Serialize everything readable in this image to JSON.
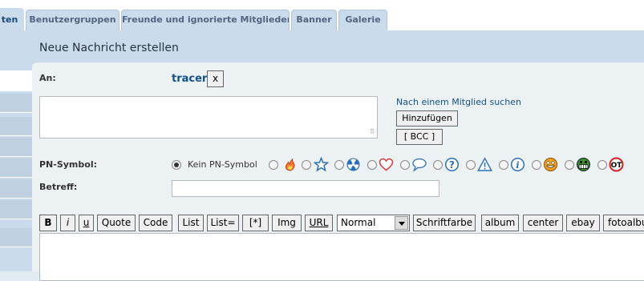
{
  "tabs": [
    {
      "label": "ten",
      "active": true
    },
    {
      "label": "Benutzergruppen"
    },
    {
      "label": "Freunde und ignorierte Mitglieder"
    },
    {
      "label": "Banner"
    },
    {
      "label": "Galerie"
    }
  ],
  "panel": {
    "title": "Neue Nachricht erstellen"
  },
  "form": {
    "to_label": "An:",
    "recipient": "tracer",
    "remove_label": "x",
    "search_member_link": "Nach einem Mitglied suchen",
    "add_button": "Hinzufügen",
    "bcc_button": "[ BCC ]",
    "pm_icon_label": "PN-Symbol:",
    "no_icon_label": "Kein PN-Symbol",
    "subject_label": "Betreff:",
    "subject_value": ""
  },
  "icons": [
    "fire-icon",
    "star-icon",
    "radioactive-icon",
    "heart-icon",
    "speech-bubble-icon",
    "question-icon",
    "warning-icon",
    "info-icon",
    "mrgreen-icon",
    "biggrin-icon",
    "offtopic-icon"
  ],
  "toolbar": {
    "bold": "B",
    "italic": "i",
    "underline": "u",
    "quote": "Quote",
    "code": "Code",
    "list": "List",
    "list_eq": "List=",
    "list_item": "[*]",
    "img": "Img",
    "url": "URL",
    "font_size": "Normal",
    "font_color": "Schriftfarbe",
    "album": "album",
    "center": "center",
    "ebay": "ebay",
    "fotoalbum": "fotoalbum"
  },
  "colors": {
    "link": "#105289",
    "panel": "#ecf1f3",
    "header": "#cadceb"
  }
}
